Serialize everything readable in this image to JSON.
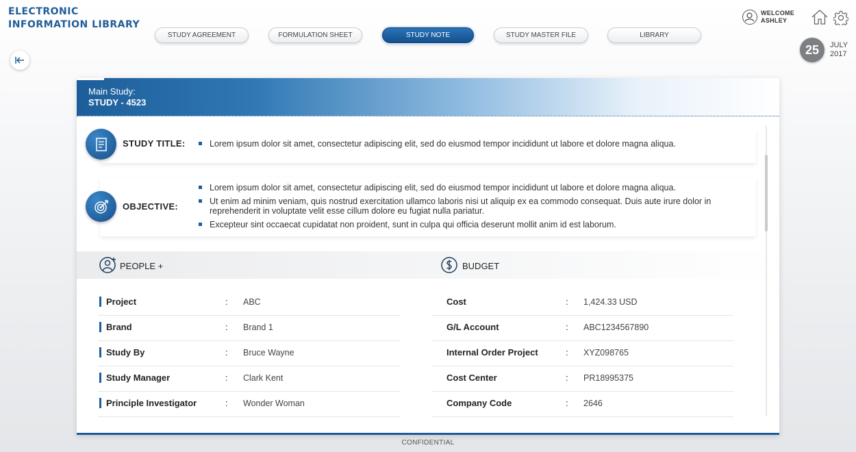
{
  "app": {
    "title_line1": "ELECTRONIC",
    "title_line2": "INFORMATION LIBRARY"
  },
  "tabs": [
    {
      "label": "STUDY AGREEMENT",
      "active": false
    },
    {
      "label": "FORMULATION SHEET",
      "active": false
    },
    {
      "label": "STUDY NOTE",
      "active": true
    },
    {
      "label": "STUDY MASTER FILE",
      "active": false
    },
    {
      "label": "LIBRARY",
      "active": false
    }
  ],
  "user": {
    "welcome": "WELCOME",
    "name": "ASHLEY"
  },
  "date": {
    "day": "25",
    "month": "JULY",
    "year": "2017"
  },
  "study": {
    "subtitle": "Main Study:",
    "id": "STUDY - 4523"
  },
  "study_title": {
    "label": "STUDY TITLE:",
    "items": [
      "Lorem ipsum dolor sit amet, consectetur adipiscing elit, sed do eiusmod tempor incididunt ut labore et dolore magna aliqua."
    ]
  },
  "objective": {
    "label": "OBJECTIVE:",
    "items": [
      "Lorem ipsum dolor sit amet, consectetur adipiscing elit, sed do eiusmod tempor incididunt ut labore et dolore magna aliqua.",
      "Ut enim ad minim veniam, quis nostrud exercitation ullamco laboris nisi ut aliquip ex ea commodo consequat. Duis aute irure dolor in reprehenderit in voluptate velit esse cillum dolore eu fugiat nulla pariatur.",
      "Excepteur sint occaecat cupidatat non proident, sunt in culpa qui officia deserunt mollit anim id est laborum."
    ]
  },
  "people": {
    "title": "PEOPLE +",
    "rows": [
      {
        "key": "Project",
        "value": "ABC"
      },
      {
        "key": "Brand",
        "value": "Brand 1"
      },
      {
        "key": "Study By",
        "value": "Bruce Wayne"
      },
      {
        "key": "Study Manager",
        "value": "Clark Kent"
      },
      {
        "key": "Principle Investigator",
        "value": "Wonder Woman"
      }
    ]
  },
  "budget": {
    "title": "BUDGET",
    "rows": [
      {
        "key": "Cost",
        "value": "1,424.33 USD"
      },
      {
        "key": "G/L Account",
        "value": "ABC1234567890"
      },
      {
        "key": "Internal Order Project",
        "value": "XYZ098765"
      },
      {
        "key": "Cost Center",
        "value": "PR18995375"
      },
      {
        "key": "Company Code",
        "value": "2646"
      }
    ]
  },
  "separator": ":",
  "footer": {
    "confidential": "CONFIDENTIAL"
  },
  "colors": {
    "accent": "#1d5e9a",
    "accent_light": "#2f78b4"
  },
  "icons": {
    "back": "back-arrow-icon",
    "home": "home-icon",
    "settings": "gear-icon",
    "user": "user-icon",
    "study_title": "document-icon",
    "objective": "target-icon",
    "people": "person-add-icon",
    "budget": "dollar-icon"
  }
}
